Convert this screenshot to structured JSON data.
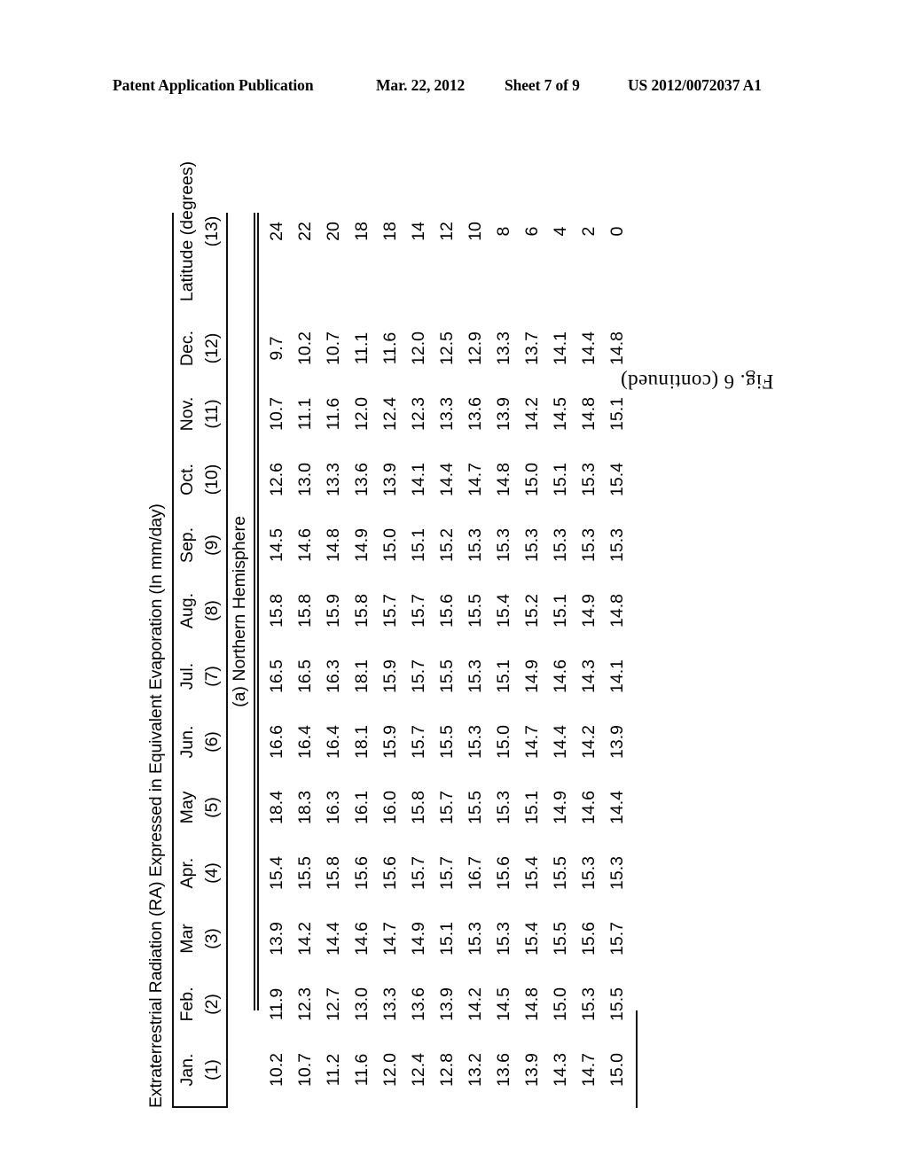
{
  "page_header": {
    "publication": "Patent Application Publication",
    "date": "Mar. 22, 2012",
    "sheet": "Sheet 7 of 9",
    "patent_number": "US 2012/0072037 A1"
  },
  "figure": {
    "caption": "Fig. 6 (continued)",
    "table_title": "Extraterrestrial Radiation (RA) Expressed in Equivalent Evaporation (In mm/day)",
    "section_label": "(a) Northern Hemisphere"
  },
  "table": {
    "columns": [
      {
        "label": "Jan.",
        "number": "(1)"
      },
      {
        "label": "Feb.",
        "number": "(2)"
      },
      {
        "label": "Mar",
        "number": "(3)"
      },
      {
        "label": "Apr.",
        "number": "(4)"
      },
      {
        "label": "May",
        "number": "(5)"
      },
      {
        "label": "Jun.",
        "number": "(6)"
      },
      {
        "label": "Jul.",
        "number": "(7)"
      },
      {
        "label": "Aug.",
        "number": "(8)"
      },
      {
        "label": "Sep.",
        "number": "(9)"
      },
      {
        "label": "Oct.",
        "number": "(10)"
      },
      {
        "label": "Nov.",
        "number": "(11)"
      },
      {
        "label": "Dec.",
        "number": "(12)"
      },
      {
        "label": "Latitude (degrees)",
        "number": "(13)"
      }
    ],
    "rows": [
      [
        "10.2",
        "11.9",
        "13.9",
        "15.4",
        "18.4",
        "16.6",
        "16.5",
        "15.8",
        "14.5",
        "12.6",
        "10.7",
        "9.7",
        "24"
      ],
      [
        "10.7",
        "12.3",
        "14.2",
        "15.5",
        "18.3",
        "16.4",
        "16.5",
        "15.8",
        "14.6",
        "13.0",
        "11.1",
        "10.2",
        "22"
      ],
      [
        "11.2",
        "12.7",
        "14.4",
        "15.8",
        "16.3",
        "16.4",
        "16.3",
        "15.9",
        "14.8",
        "13.3",
        "11.6",
        "10.7",
        "20"
      ],
      [
        "11.6",
        "13.0",
        "14.6",
        "15.6",
        "16.1",
        "18.1",
        "18.1",
        "15.8",
        "14.9",
        "13.6",
        "12.0",
        "11.1",
        "18"
      ],
      [
        "12.0",
        "13.3",
        "14.7",
        "15.6",
        "16.0",
        "15.9",
        "15.9",
        "15.7",
        "15.0",
        "13.9",
        "12.4",
        "11.6",
        "18"
      ],
      [
        "12.4",
        "13.6",
        "14.9",
        "15.7",
        "15.8",
        "15.7",
        "15.7",
        "15.7",
        "15.1",
        "14.1",
        "12.3",
        "12.0",
        "14"
      ],
      [
        "12.8",
        "13.9",
        "15.1",
        "15.7",
        "15.7",
        "15.5",
        "15.5",
        "15.6",
        "15.2",
        "14.4",
        "13.3",
        "12.5",
        "12"
      ],
      [
        "13.2",
        "14.2",
        "15.3",
        "16.7",
        "15.5",
        "15.3",
        "15.3",
        "15.5",
        "15.3",
        "14.7",
        "13.6",
        "12.9",
        "10"
      ],
      [
        "13.6",
        "14.5",
        "15.3",
        "15.6",
        "15.3",
        "15.0",
        "15.1",
        "15.4",
        "15.3",
        "14.8",
        "13.9",
        "13.3",
        "8"
      ],
      [
        "13.9",
        "14.8",
        "15.4",
        "15.4",
        "15.1",
        "14.7",
        "14.9",
        "15.2",
        "15.3",
        "15.0",
        "14.2",
        "13.7",
        "6"
      ],
      [
        "14.3",
        "15.0",
        "15.5",
        "15.5",
        "14.9",
        "14.4",
        "14.6",
        "15.1",
        "15.3",
        "15.1",
        "14.5",
        "14.1",
        "4"
      ],
      [
        "14.7",
        "15.3",
        "15.6",
        "15.3",
        "14.6",
        "14.2",
        "14.3",
        "14.9",
        "15.3",
        "15.3",
        "14.8",
        "14.4",
        "2"
      ],
      [
        "15.0",
        "15.5",
        "15.7",
        "15.3",
        "14.4",
        "13.9",
        "14.1",
        "14.8",
        "15.3",
        "15.4",
        "15.1",
        "14.8",
        "0"
      ]
    ]
  }
}
